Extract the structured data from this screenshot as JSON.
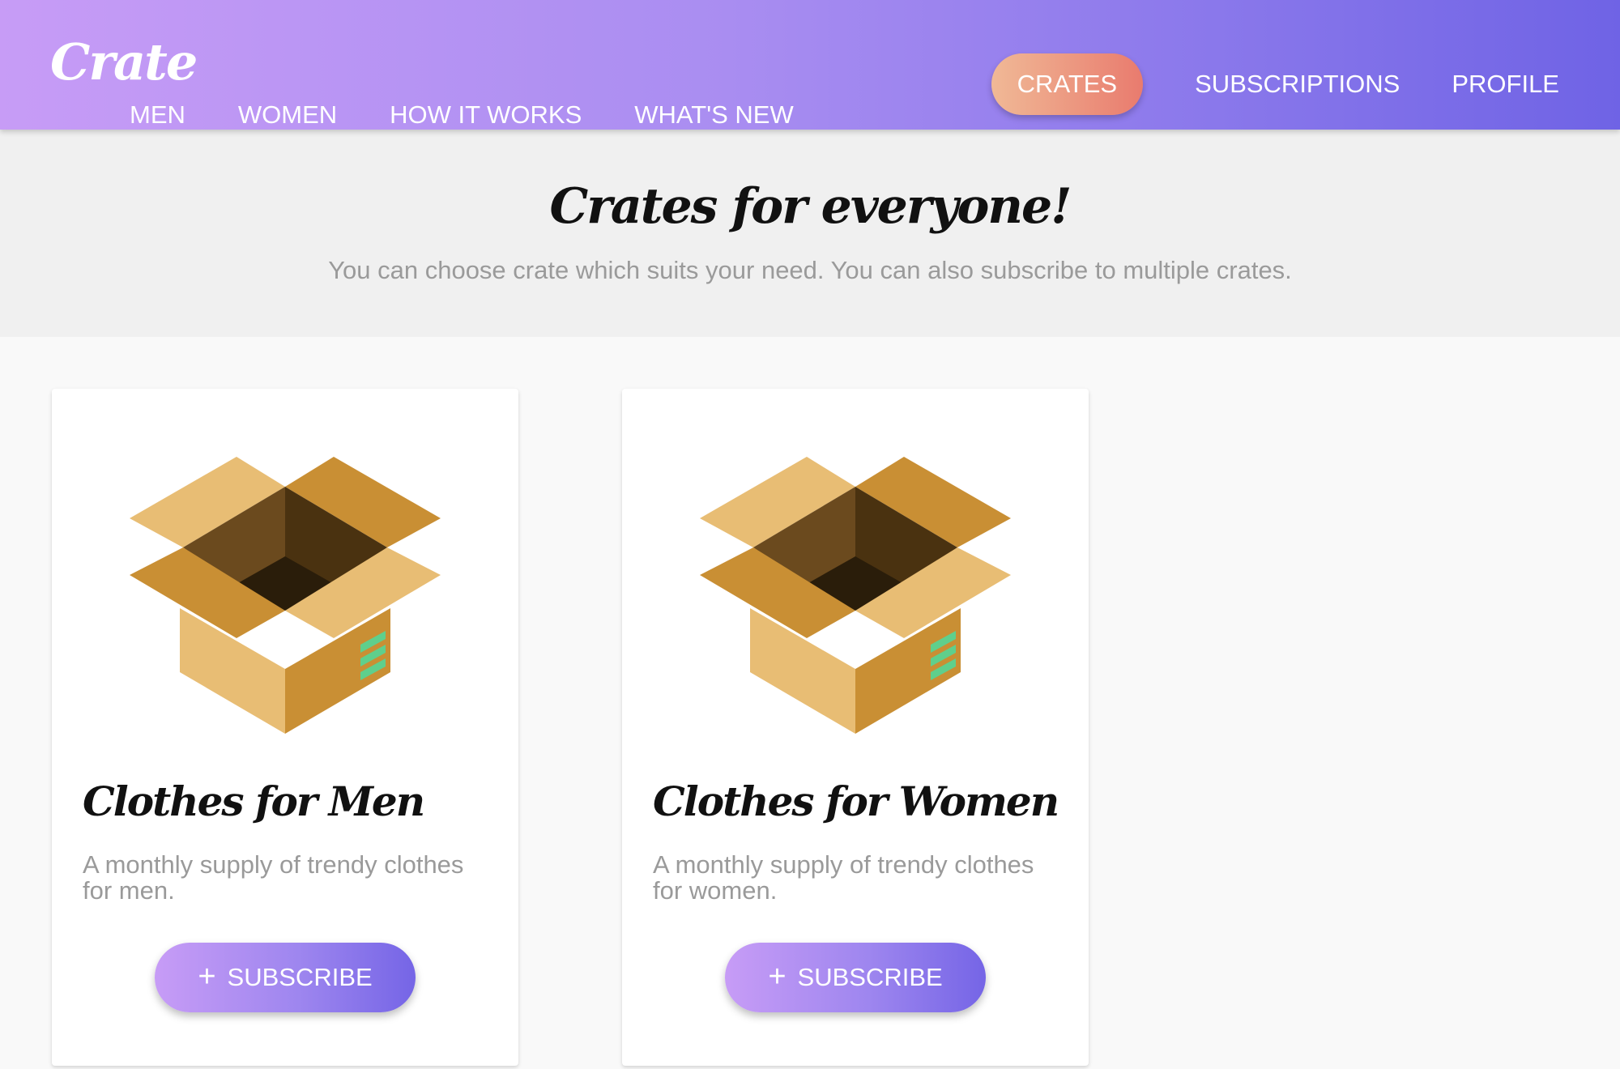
{
  "header": {
    "logo": "Crate",
    "nav_left": [
      {
        "label": "MEN"
      },
      {
        "label": "WOMEN"
      },
      {
        "label": "HOW IT WORKS"
      },
      {
        "label": "WHAT'S NEW"
      }
    ],
    "nav_right": [
      {
        "label": "CRATES",
        "active": true
      },
      {
        "label": "SUBSCRIPTIONS"
      },
      {
        "label": "PROFILE"
      }
    ]
  },
  "hero": {
    "title": "Crates for everyone!",
    "subtitle": "You can choose crate which suits your need. You can also subscribe to multiple crates."
  },
  "cards": [
    {
      "image_icon": "open-box-icon",
      "title": "Clothes for Men",
      "description": "A monthly supply of trendy clothes for men.",
      "button_label": "SUBSCRIBE",
      "button_icon": "plus-icon"
    },
    {
      "image_icon": "open-box-icon",
      "title": "Clothes for Women",
      "description": "A monthly supply of trendy clothes for women.",
      "button_label": "SUBSCRIBE",
      "button_icon": "plus-icon"
    }
  ],
  "colors": {
    "header_gradient_start": "#c79cf6",
    "header_gradient_end": "#6f63e5",
    "active_pill_start": "#f0b996",
    "active_pill_end": "#e97b6e",
    "hero_background": "#f0f0f0",
    "page_background": "#f9f9f9",
    "muted_text": "#9a9a9a",
    "box_light": "#e8bd74",
    "box_dark": "#c98f34",
    "box_stripe": "#5fcf8c"
  }
}
